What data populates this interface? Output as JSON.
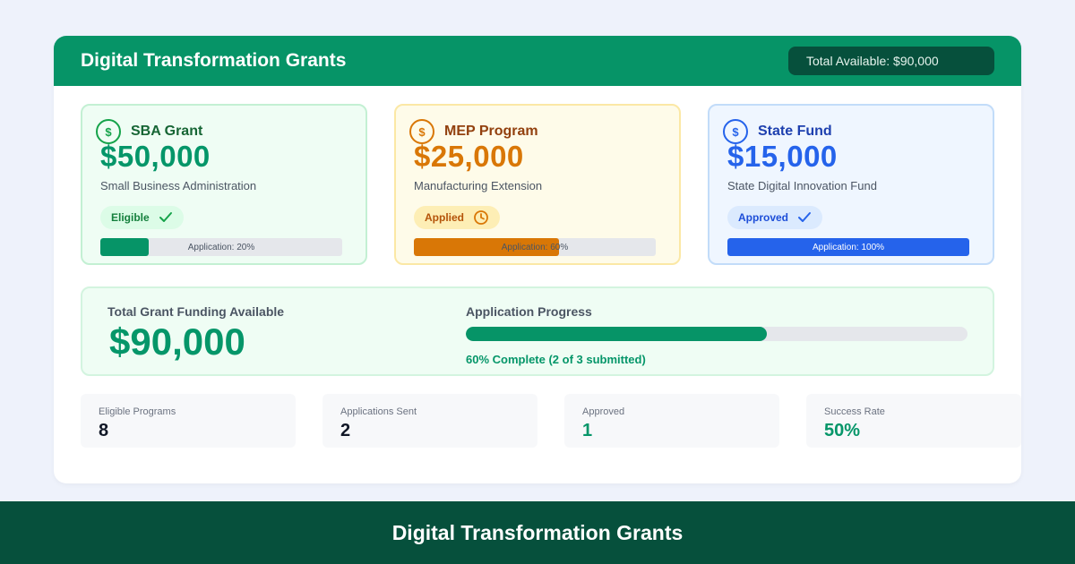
{
  "header": {
    "title": "Digital Transformation Grants",
    "total_available": "Total Available: $90,000"
  },
  "grants": [
    {
      "coin_symbol": "$",
      "name": "SBA Grant",
      "amount": "$50,000",
      "description": "Small Business Administration",
      "status": "Eligible",
      "status_icon": "check-icon",
      "progress": 0.2,
      "progress_label": "Application: 20%"
    },
    {
      "coin_symbol": "$",
      "name": "MEP Program",
      "amount": "$25,000",
      "description": "Manufacturing Extension",
      "status": "Applied",
      "status_icon": "clock-icon",
      "progress": 0.6,
      "progress_label": "Application: 60%"
    },
    {
      "coin_symbol": "$",
      "name": "State Fund",
      "amount": "$15,000",
      "description": "State Digital Innovation Fund",
      "status": "Approved",
      "status_icon": "check-icon",
      "progress": 1.0,
      "progress_label": "Application: 100%"
    }
  ],
  "summary": {
    "funding_label": "Total Grant Funding Available",
    "funding_amount": "$90,000",
    "progress_label": "Application Progress",
    "progress": 0.6,
    "progress_text": "60% Complete (2 of 3 submitted)"
  },
  "stats": [
    {
      "label": "Eligible Programs",
      "value": "8"
    },
    {
      "label": "Applications Sent",
      "value": "2"
    },
    {
      "label": "Approved",
      "value": "1"
    },
    {
      "label": "Success Rate",
      "value": "50%"
    }
  ],
  "footer": {
    "title": "Digital Transformation Grants"
  },
  "colors": {
    "brand_green": "#069467",
    "dark_green": "#06503c",
    "amber": "#d97706",
    "blue": "#2563eb"
  }
}
